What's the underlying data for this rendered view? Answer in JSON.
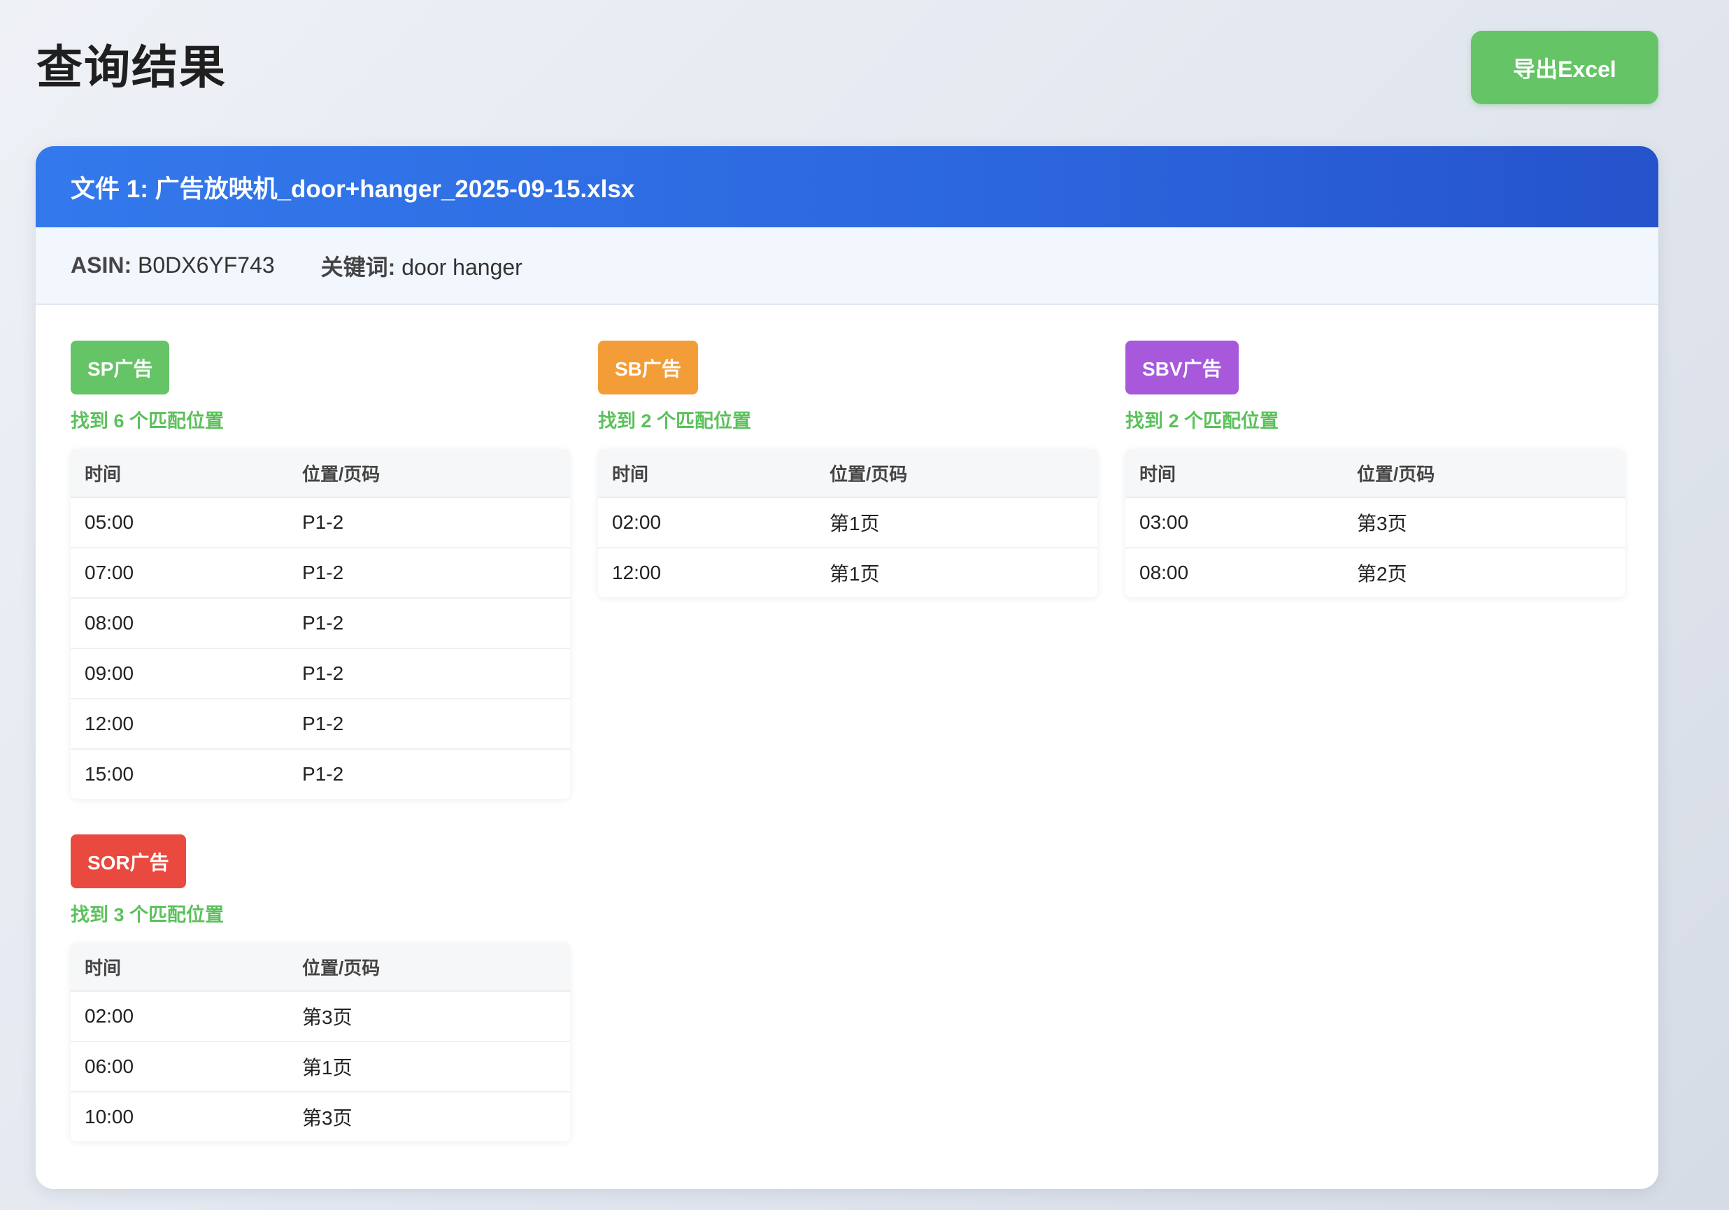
{
  "page": {
    "title": "查询结果",
    "export_label": "导出Excel"
  },
  "file": {
    "header": "文件 1: 广告放映机_door+hanger_2025-09-15.xlsx",
    "asin_label": "ASIN:",
    "asin_value": "B0DX6YF743",
    "keyword_label": "关键词:",
    "keyword_value": "door hanger"
  },
  "table_headers": {
    "time": "时间",
    "position": "位置/页码"
  },
  "colors": {
    "sp": "#65c466",
    "sb": "#f29d38",
    "sbv": "#a758db",
    "sor": "#e9493e",
    "header_blue": "#2e6de6",
    "match_green": "#5cc15c"
  },
  "sections": [
    {
      "key": "sp",
      "label": "SP广告",
      "match_text": "找到 6 个匹配位置",
      "rows": [
        {
          "time": "05:00",
          "position": "P1-2"
        },
        {
          "time": "07:00",
          "position": "P1-2"
        },
        {
          "time": "08:00",
          "position": "P1-2"
        },
        {
          "time": "09:00",
          "position": "P1-2"
        },
        {
          "time": "12:00",
          "position": "P1-2"
        },
        {
          "time": "15:00",
          "position": "P1-2"
        }
      ]
    },
    {
      "key": "sb",
      "label": "SB广告",
      "match_text": "找到 2 个匹配位置",
      "rows": [
        {
          "time": "02:00",
          "position": "第1页"
        },
        {
          "time": "12:00",
          "position": "第1页"
        }
      ]
    },
    {
      "key": "sbv",
      "label": "SBV广告",
      "match_text": "找到 2 个匹配位置",
      "rows": [
        {
          "time": "03:00",
          "position": "第3页"
        },
        {
          "time": "08:00",
          "position": "第2页"
        }
      ]
    },
    {
      "key": "sor",
      "label": "SOR广告",
      "match_text": "找到 3 个匹配位置",
      "rows": [
        {
          "time": "02:00",
          "position": "第3页"
        },
        {
          "time": "06:00",
          "position": "第1页"
        },
        {
          "time": "10:00",
          "position": "第3页"
        }
      ]
    }
  ]
}
